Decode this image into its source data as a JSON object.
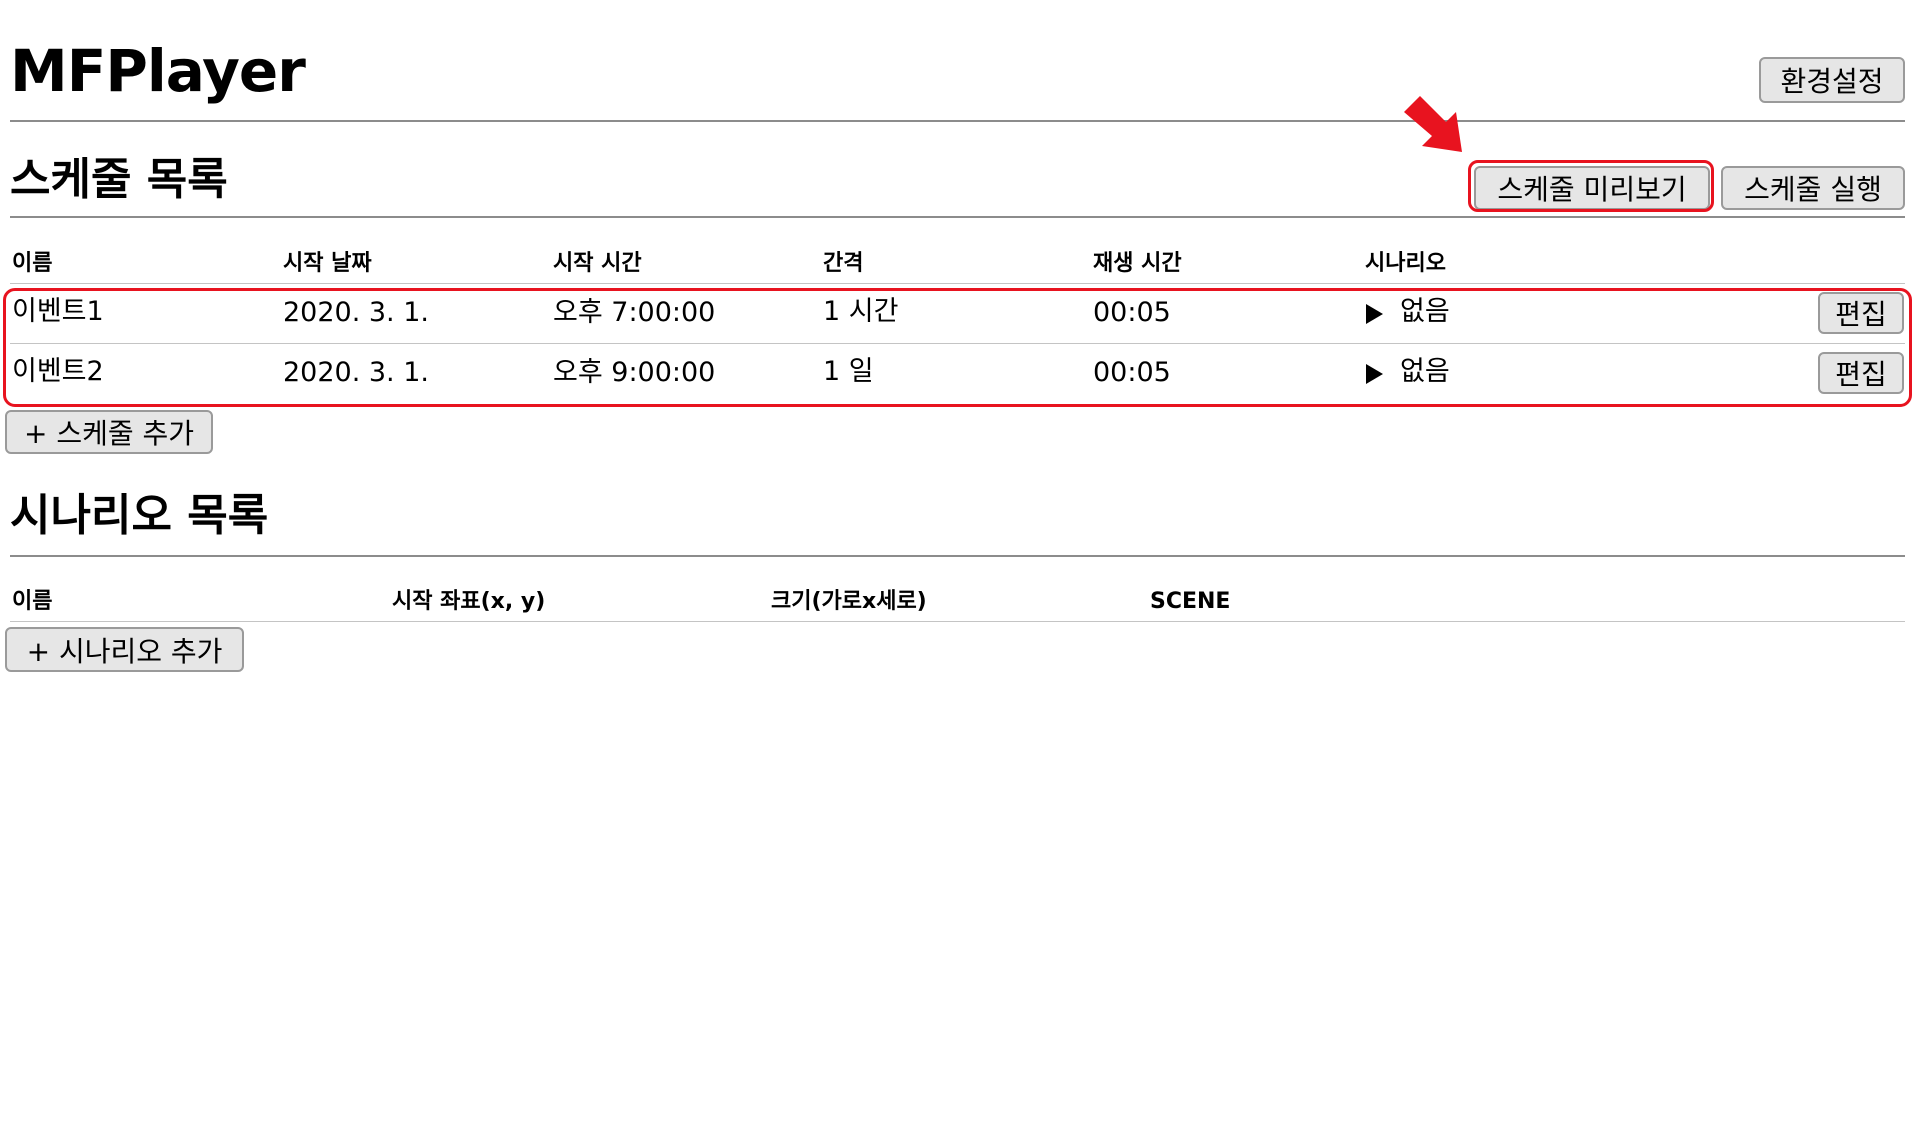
{
  "app": {
    "title": "MFPlayer",
    "settings_label": "환경설정"
  },
  "schedule": {
    "title": "스케줄 목록",
    "preview_label": "스케줄 미리보기",
    "run_label": "스케줄 실행",
    "columns": [
      "이름",
      "시작 날짜",
      "시작 시간",
      "간격",
      "재생 시간",
      "시나리오"
    ],
    "rows": [
      {
        "name": "이벤트1",
        "date": "2020. 3. 1.",
        "time": "오후 7:00:00",
        "interval": "1 시간",
        "duration": "00:05",
        "scenario": "없음",
        "edit_label": "편집"
      },
      {
        "name": "이벤트2",
        "date": "2020. 3. 1.",
        "time": "오후 9:00:00",
        "interval": "1 일",
        "duration": "00:05",
        "scenario": "없음",
        "edit_label": "편집"
      }
    ],
    "add_label": "+ 스케줄 추가"
  },
  "scenario": {
    "title": "시나리오 목록",
    "columns": [
      "이름",
      "시작 좌표(x, y)",
      "크기(가로x세로)",
      "SCENE"
    ],
    "add_label": "+ 시나리오 추가"
  },
  "icons": {
    "play": "play-icon",
    "arrow": "red-arrow-icon"
  },
  "colors": {
    "highlight": "#e8131f",
    "button_bg": "#e6e6e6"
  }
}
